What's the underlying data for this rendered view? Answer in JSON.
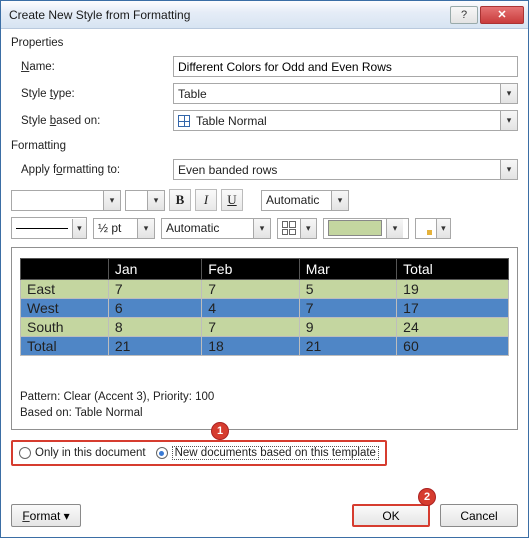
{
  "titlebar": {
    "title": "Create New Style from Formatting"
  },
  "properties": {
    "group_label": "Properties",
    "name_label": "Name:",
    "name_value": "Different Colors for Odd and Even Rows",
    "style_type_label": "Style type:",
    "style_type_value": "Table",
    "style_based_on_label": "Style based on:",
    "style_based_on_value": "Table Normal"
  },
  "formatting": {
    "group_label": "Formatting",
    "apply_to_label": "Apply formatting to:",
    "apply_to_value": "Even banded rows",
    "font_name": "",
    "font_size": "",
    "font_color_label": "Automatic",
    "line_weight": "½ pt",
    "border_color_label": "Automatic",
    "shading_color": "#c4d6a0"
  },
  "preview_table": {
    "headers": [
      "",
      "Jan",
      "Feb",
      "Mar",
      "Total"
    ],
    "rows": [
      {
        "style": "green",
        "cells": [
          "East",
          "7",
          "7",
          "5",
          "19"
        ]
      },
      {
        "style": "blue",
        "cells": [
          "West",
          "6",
          "4",
          "7",
          "17"
        ]
      },
      {
        "style": "green",
        "cells": [
          "South",
          "8",
          "7",
          "9",
          "24"
        ]
      },
      {
        "style": "blue",
        "cells": [
          "Total",
          "21",
          "18",
          "21",
          "60"
        ]
      }
    ]
  },
  "info": {
    "line1": "Pattern: Clear (Accent 3), Priority: 100",
    "line2": "Based on: Table Normal"
  },
  "scope": {
    "only_doc_label": "Only in this document",
    "new_docs_label": "New documents based on this template",
    "selected": "new_docs"
  },
  "buttons": {
    "format_label": "Format",
    "ok_label": "OK",
    "cancel_label": "Cancel"
  },
  "callouts": {
    "one": "1",
    "two": "2"
  }
}
